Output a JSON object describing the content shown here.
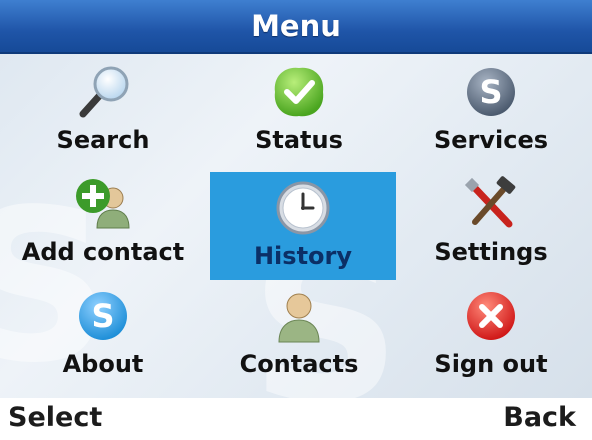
{
  "header": {
    "title": "Menu"
  },
  "menu": {
    "items": [
      {
        "label": "Search",
        "icon": "magnifier-icon"
      },
      {
        "label": "Status",
        "icon": "status-check-icon"
      },
      {
        "label": "Services",
        "icon": "skype-logo-icon"
      },
      {
        "label": "Add contact",
        "icon": "add-contact-icon"
      },
      {
        "label": "History",
        "icon": "clock-icon",
        "selected": true
      },
      {
        "label": "Settings",
        "icon": "tools-icon"
      },
      {
        "label": "About",
        "icon": "skype-logo-icon"
      },
      {
        "label": "Contacts",
        "icon": "person-icon"
      },
      {
        "label": "Sign out",
        "icon": "sign-out-x-icon"
      }
    ]
  },
  "softkeys": {
    "left": "Select",
    "right": "Back"
  },
  "colors": {
    "title_bar": "#1f55a8",
    "selection": "#2a9cde",
    "status_green": "#5fba2e",
    "skype_blue": "#1f8fd8",
    "sign_out_red": "#e02020"
  }
}
